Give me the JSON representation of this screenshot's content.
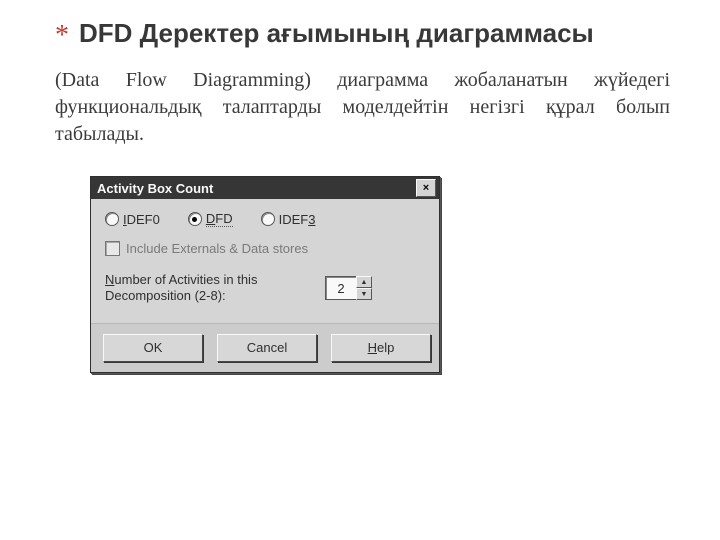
{
  "heading": {
    "marker": "*",
    "text": "DFD Деректер ағымының диаграммасы"
  },
  "paragraph": "(Data Flow Diagramming) диаграмма жобаланатын жүйедегі функциональдық талаптарды моделдейтін негізгі құрал болып табылады.",
  "dialog": {
    "title": "Activity Box Count",
    "close": "×",
    "radios": {
      "idef0": {
        "mnemonic": "I",
        "rest": "DEF0",
        "checked": false
      },
      "dfd": {
        "mnemonic": "D",
        "rest": "FD",
        "checked": true
      },
      "idef3": {
        "mnemonic_tail": "3",
        "prefix": "IDEF",
        "checked": false
      }
    },
    "checkbox": {
      "label": "Include Externals & Data stores",
      "checked": false,
      "disabled": true
    },
    "number": {
      "label_line1": "Number of Activities in this",
      "label_line2": "Decomposition (2-8):",
      "mnemonic": "N",
      "value": "2"
    },
    "buttons": {
      "ok": {
        "text": "OK"
      },
      "cancel": {
        "text": "Cancel"
      },
      "help": {
        "mnemonic": "H",
        "rest": "elp"
      }
    }
  }
}
